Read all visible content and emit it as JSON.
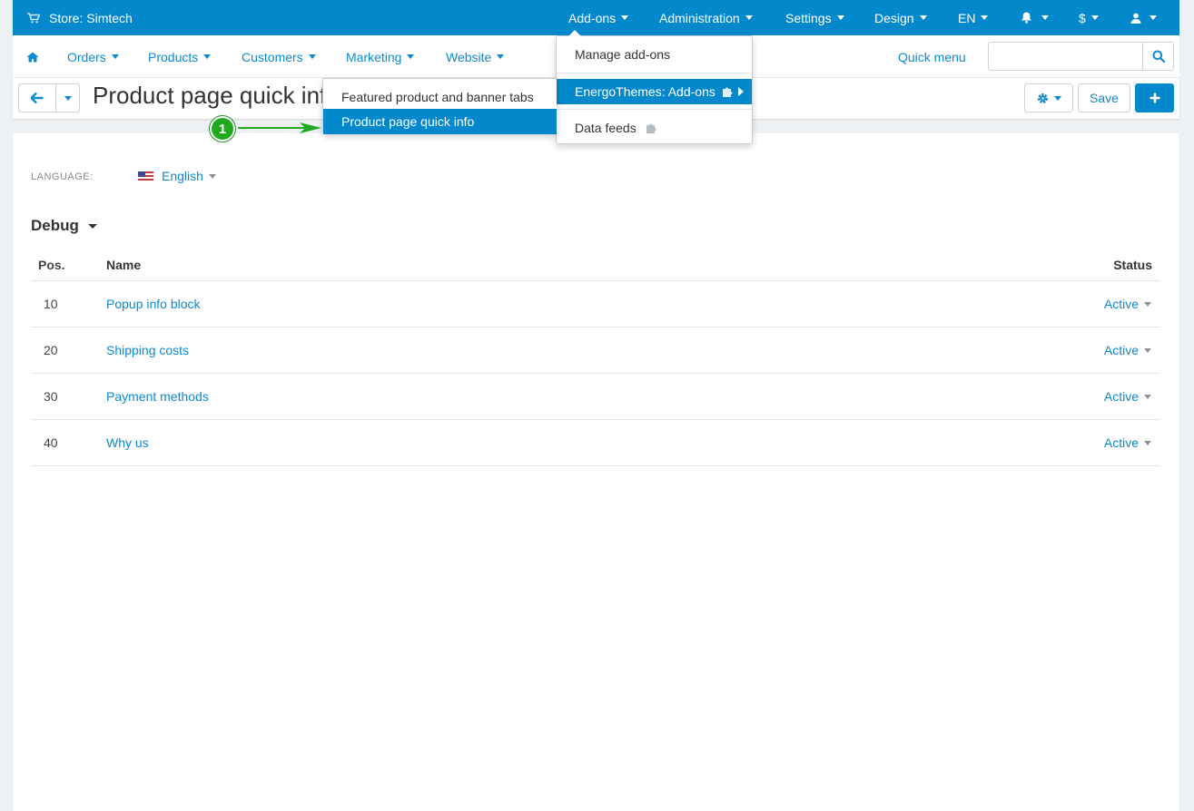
{
  "colors": {
    "primary": "#0388cc",
    "link": "#0e8ace",
    "annotation": "#20a81f"
  },
  "topbar": {
    "store_label": "Store: Simtech",
    "store_icon": "cart-icon",
    "items": [
      {
        "label": "Add-ons"
      },
      {
        "label": "Administration"
      },
      {
        "label": "Settings"
      },
      {
        "label": "Design"
      },
      {
        "label": "EN"
      }
    ],
    "currency": "$"
  },
  "nav": {
    "items": [
      {
        "label": "Orders"
      },
      {
        "label": "Products"
      },
      {
        "label": "Customers"
      },
      {
        "label": "Marketing"
      },
      {
        "label": "Website"
      }
    ],
    "quick_menu": "Quick menu",
    "search_placeholder": ""
  },
  "titlebar": {
    "title": "Product page quick info",
    "save_label": "Save"
  },
  "addons_menu": {
    "items": [
      {
        "label": "Manage add-ons"
      },
      {
        "label": "EnergoThemes: Add-ons"
      },
      {
        "label": "Data feeds"
      }
    ]
  },
  "submenu": {
    "items": [
      {
        "label": "Featured product and banner tabs"
      },
      {
        "label": "Product page quick info"
      }
    ]
  },
  "annotation": {
    "number": "1"
  },
  "content": {
    "language_label": "LANGUAGE:",
    "language_value": "English",
    "section_title": "Debug",
    "columns": {
      "pos": "Pos.",
      "name": "Name",
      "status": "Status"
    },
    "rows": [
      {
        "pos": "10",
        "name": "Popup info block",
        "status": "Active"
      },
      {
        "pos": "20",
        "name": "Shipping costs",
        "status": "Active"
      },
      {
        "pos": "30",
        "name": "Payment methods",
        "status": "Active"
      },
      {
        "pos": "40",
        "name": "Why us",
        "status": "Active"
      }
    ]
  }
}
